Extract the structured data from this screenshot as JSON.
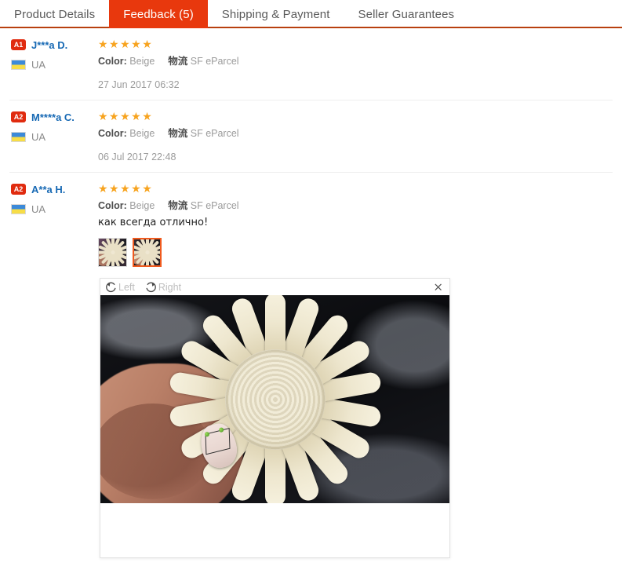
{
  "tabs": [
    {
      "label": "Product Details",
      "active": false
    },
    {
      "label": "Feedback (5)",
      "active": true
    },
    {
      "label": "Shipping & Payment",
      "active": false
    },
    {
      "label": "Seller Guarantees",
      "active": false
    }
  ],
  "colors": {
    "accent": "#e8380d",
    "tab_border": "#b8400f",
    "star": "#f7a31e",
    "link": "#1769b4",
    "badge": "#e02b0f",
    "thumb_selected": "#f05a1e"
  },
  "labels": {
    "color_key": "Color:",
    "logistics_key": "物流"
  },
  "feedback": [
    {
      "level_badge": "A1",
      "user_name": "J***a D.",
      "country": "UA",
      "stars": "★★★★★",
      "rating": 5,
      "color_value": "Beige",
      "logistics_value": "SF eParcel",
      "date": "27 Jun 2017 06:32",
      "text": "",
      "photos": []
    },
    {
      "level_badge": "A2",
      "user_name": "M****a C.",
      "country": "UA",
      "stars": "★★★★★",
      "rating": 5,
      "color_value": "Beige",
      "logistics_value": "SF eParcel",
      "date": "06 Jul 2017 22:48",
      "text": "",
      "photos": []
    },
    {
      "level_badge": "A2",
      "user_name": "A**a H.",
      "country": "UA",
      "stars": "★★★★★",
      "rating": 5,
      "color_value": "Beige",
      "logistics_value": "SF eParcel",
      "date": "",
      "text": "как всегда отлично!",
      "photos": [
        {
          "alt": "nail tip wheel photo 1",
          "selected": false
        },
        {
          "alt": "nail tip wheel photo 2",
          "selected": true
        }
      ]
    }
  ],
  "viewer": {
    "rotate_left_label": "Left",
    "rotate_right_label": "Right",
    "close_label": "×",
    "image_alt": "Hand holding a circular nail tip display wheel with beige nail tips in plastic packaging"
  }
}
